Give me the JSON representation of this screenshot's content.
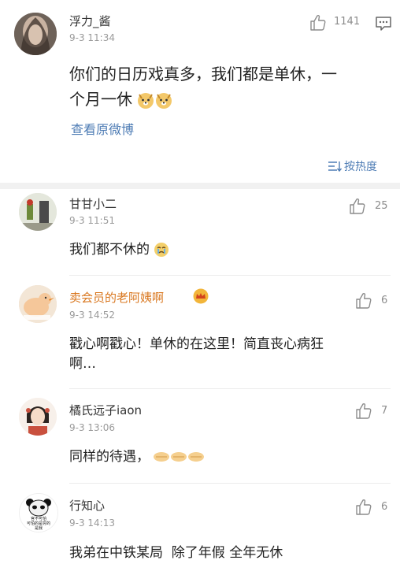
{
  "main_comment": {
    "author": "浮力_酱",
    "time": "9-3 11:34",
    "like_count": "1141",
    "text_line1": "你们的日历戏真多，我们都是单休，一",
    "text_line2": "个月一休",
    "text_emoji": "doge-emoji",
    "view_original": "查看原微博"
  },
  "sort_label": "按热度",
  "replies": [
    {
      "author": "甘甘小二",
      "time": "9-3 11:51",
      "like_count": "25",
      "text": "我们都不休的",
      "emoji": "crying-emoji"
    },
    {
      "author": "卖会员的老阿姨啊",
      "time": "9-3 14:52",
      "like_count": "6",
      "text_line1": "戳心啊戳心！单休的在这里！简直丧心病狂",
      "text_line2": "啊…",
      "badge": "crown-badge-icon",
      "author_color": "#d9771f"
    },
    {
      "author": "橘氏远子iaon",
      "time": "9-3 13:06",
      "like_count": "7",
      "text": "同样的待遇，",
      "emoji": "folded-hands-emoji"
    },
    {
      "author": "行知心",
      "time": "9-3 14:13",
      "like_count": "6",
      "text": "我弟在中铁某局  除了年假 全年无休",
      "avatar_text_1": "官不可怕",
      "avatar_text_2": "可怕的是穷的",
      "avatar_text_3": "是我"
    }
  ],
  "colors": {
    "link": "#4f7db5",
    "time": "#9a9a9a",
    "like": "#8c8c8c",
    "band": "#f1f1f1"
  }
}
